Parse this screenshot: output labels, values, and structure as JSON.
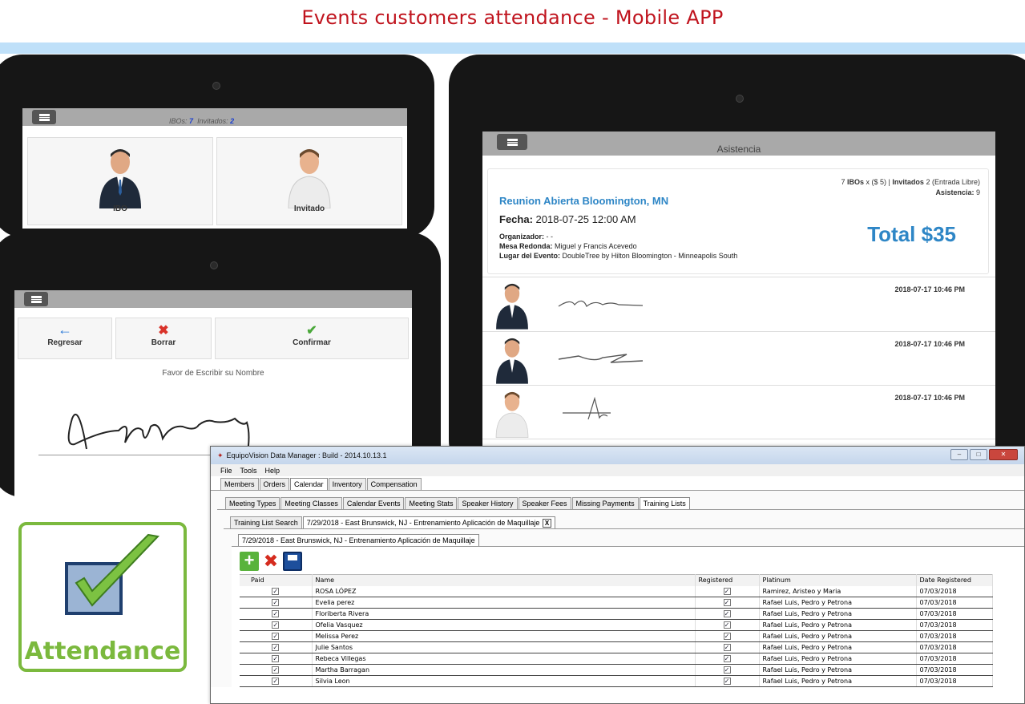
{
  "page": {
    "title": "Events customers attendance - Mobile APP"
  },
  "tablet1": {
    "ibos_label": "IBOs:",
    "ibos_count": "7",
    "inv_label": "Invitados:",
    "inv_count": "2",
    "tile_ibo": "IBO",
    "tile_invitado": "Invitado"
  },
  "tablet2": {
    "back": "Regresar",
    "delete": "Borrar",
    "confirm": "Confirmar",
    "prompt": "Favor de Escribir su Nombre"
  },
  "tablet3": {
    "header": "Asistencia",
    "summary_count": "7",
    "summary_ibos": "IBOs",
    "summary_price": "x ($ 5) |",
    "summary_inv": "Invitados",
    "summary_inv_count": "2 (Entrada Libre)",
    "attend_label": "Asistencia:",
    "attend_count": "9",
    "event_title": "Reunion Abierta Bloomington, MN",
    "fecha_label": "Fecha:",
    "fecha_value": "2018-07-25 12:00 AM",
    "org_label": "Organizador:",
    "org_value": "- -",
    "mesa_label": "Mesa Redonda:",
    "mesa_value": "Miguel y Francis Acevedo",
    "lugar_label": "Lugar del Evento:",
    "lugar_value": "DoubleTree by Hilton Bloomington - Minneapolis South",
    "total": "Total $35",
    "rows": [
      {
        "time": "2018-07-17 10:46 PM"
      },
      {
        "time": "2018-07-17 10:46 PM"
      },
      {
        "time": "2018-07-17 10:46 PM"
      }
    ]
  },
  "logo": {
    "text": "Attendance"
  },
  "desktop": {
    "title": "EquipoVision Data Manager : Build - 2014.10.13.1",
    "menu": [
      "File",
      "Tools",
      "Help"
    ],
    "main_tabs": [
      "Members",
      "Orders",
      "Calendar",
      "Inventory",
      "Compensation"
    ],
    "sub_tabs": [
      "Meeting Types",
      "Meeting Classes",
      "Calendar Events",
      "Meeting Stats",
      "Speaker History",
      "Speaker Fees",
      "Missing Payments",
      "Training Lists"
    ],
    "doc_tabs": [
      "Training List Search",
      "7/29/2018 - East Brunswick, NJ - Entrenamiento Aplicación de Maquillaje"
    ],
    "inner_tab": "7/29/2018 - East Brunswick, NJ - Entrenamiento Aplicación de Maquillaje",
    "columns": [
      "Paid",
      "Name",
      "Registered",
      "Platinum",
      "Date Registered"
    ],
    "rows": [
      {
        "name": "ROSA LÓPEZ",
        "platinum": "Ramirez, Aristeo y Maria",
        "date": "07/03/2018"
      },
      {
        "name": "Evelia perez",
        "platinum": "Rafael Luis, Pedro y Petrona",
        "date": "07/03/2018"
      },
      {
        "name": "Floriberta Rivera",
        "platinum": "Rafael Luis, Pedro y Petrona",
        "date": "07/03/2018"
      },
      {
        "name": "Ofelia Vasquez",
        "platinum": "Rafael Luis, Pedro y Petrona",
        "date": "07/03/2018"
      },
      {
        "name": "Melissa Perez",
        "platinum": "Rafael Luis, Pedro y Petrona",
        "date": "07/03/2018"
      },
      {
        "name": "Julie Santos",
        "platinum": "Rafael Luis, Pedro y Petrona",
        "date": "07/03/2018"
      },
      {
        "name": " Rebeca Villegas",
        "platinum": "Rafael Luis, Pedro y Petrona",
        "date": "07/03/2018"
      },
      {
        "name": "Martha Barragan",
        "platinum": "Rafael Luis, Pedro y Petrona",
        "date": "07/03/2018"
      },
      {
        "name": "Silvia Leon",
        "platinum": "Rafael Luis, Pedro y Petrona",
        "date": "07/03/2018"
      }
    ]
  }
}
